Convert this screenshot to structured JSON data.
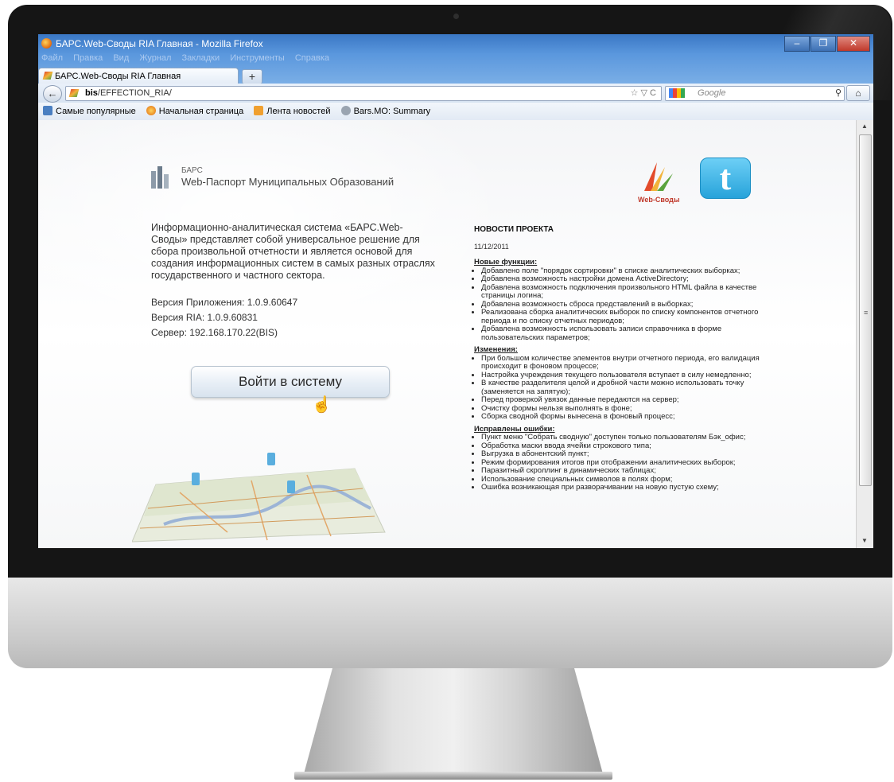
{
  "window": {
    "title": "БАРС.Web-Своды RIA Главная - Mozilla Firefox",
    "menu": [
      "Файл",
      "Правка",
      "Вид",
      "Журнал",
      "Закладки",
      "Инструменты",
      "Справка"
    ],
    "controls": {
      "minimize": "–",
      "maximize": "❐",
      "close": "✕"
    }
  },
  "browser": {
    "tab_title": "БАРС.Web-Своды RIA Главная",
    "new_tab": "+",
    "url_host": "bis",
    "url_path": "/EFFECTION_RIA/",
    "url_tools": "☆ ▽ C",
    "search_placeholder": "Google",
    "search_icon": "⚲",
    "home_icon": "⌂",
    "back_icon": "←",
    "bookmarks": [
      "Самые популярные",
      "Начальная страница",
      "Лента новостей",
      "Bars.MO: Summary"
    ]
  },
  "page": {
    "logo_small": "БАРС",
    "logo_text": "Web-Паспорт Муниципальных Образований",
    "description": "Информационно-аналитическая система «БАРС.Web-Своды» представляет собой универсальное решение для сбора произвольной отчетности и является основой для создания информационных систем в самых разных отраслях государственного и частного сектора.",
    "version_app": "Версия Приложения: 1.0.9.60647",
    "version_ria": "Версия RIA: 1.0.9.60831",
    "server": "Сервер: 192.168.170.22(BIS)",
    "login_button": "Войти в систему",
    "websvody_label": "Web-Своды",
    "twitter_letter": "t"
  },
  "news": {
    "heading": "НОВОСТИ ПРОЕКТА",
    "date": "11/12/2011",
    "sections": [
      {
        "title": "Новые функции:",
        "items": [
          "Добавлено поле \"порядок сортировки\" в списке аналитических выборках;",
          "Добавлена возможность настройки домена ActiveDirectory;",
          "Добавлена возможность подключения произвольного HTML файла в качестве страницы логина;",
          "Добавлена возможность сброса представлений в выборках;",
          "Реализована сборка аналитических выборок по списку компонентов отчетного периода и по списку отчетных периодов;",
          "Добавлена возможность использовать записи справочника в форме пользовательских параметров;"
        ]
      },
      {
        "title": "Изменения:",
        "items": [
          "При большом количестве элементов внутри отчетного периода, его валидация происходит в фоновом процессе;",
          "Настройка учреждения текущего пользователя вступает в силу немедленно;",
          "В качестве разделителя целой и дробной части можно использовать точку (заменяется на запятую);",
          "Перед проверкой увязок данные передаются на сервер;",
          "Очистку формы нельзя выполнять в фоне;",
          "Сборка сводной формы вынесена в фоновый процесс;"
        ]
      },
      {
        "title": "Исправлены ошибки:",
        "items": [
          "Пункт меню \"Собрать сводную\" доступен только пользователям Бэк_офис;",
          "Обработка маски ввода ячейки строкового типа;",
          "Выгрузка в абонентский пункт;",
          "Режим формирования итогов при отображении аналитических выборок;",
          "Паразитный скроллинг в динамических таблицах;",
          "Использование специальных символов в полях форм;",
          "Ошибка возникающая при разворачивании на новую пустую схему;"
        ]
      }
    ]
  }
}
